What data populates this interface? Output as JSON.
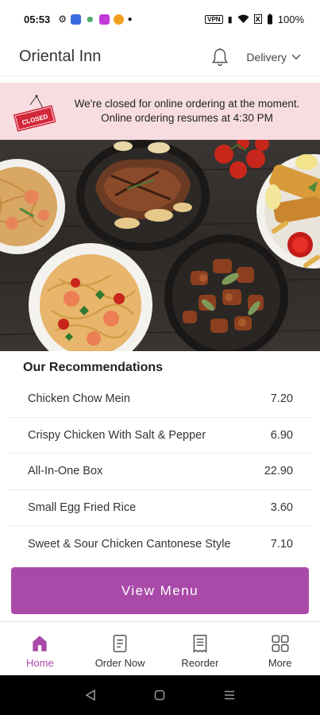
{
  "status_bar": {
    "time": "05:53",
    "vpn": "VPN",
    "battery": "100%"
  },
  "header": {
    "title": "Oriental Inn",
    "delivery_label": "Delivery"
  },
  "banner": {
    "sign_text": "CLOSED",
    "line1": "We're closed for online ordering at the moment.",
    "line2": "Online ordering resumes at 4:30 PM"
  },
  "recommendations": {
    "title": "Our Recommendations",
    "items": [
      {
        "name": "Chicken Chow Mein",
        "price": "7.20"
      },
      {
        "name": "Crispy Chicken With Salt & Pepper",
        "price": "6.90"
      },
      {
        "name": "All-In-One Box",
        "price": "22.90"
      },
      {
        "name": "Small Egg Fried Rice",
        "price": "3.60"
      },
      {
        "name": "Sweet & Sour Chicken Cantonese Style",
        "price": "7.10"
      }
    ]
  },
  "view_menu_label": "View Menu",
  "bottom_nav": {
    "home": "Home",
    "order_now": "Order Now",
    "reorder": "Reorder",
    "more": "More"
  },
  "colors": {
    "accent": "#a94aa8",
    "banner_bg": "#f7dde2",
    "closed_sign": "#d3283a"
  },
  "icons": [
    "bell-icon",
    "chevron-down-icon",
    "home-icon",
    "order-icon",
    "receipt-icon",
    "grid-icon",
    "back-icon",
    "home-circle-icon",
    "recents-icon"
  ]
}
